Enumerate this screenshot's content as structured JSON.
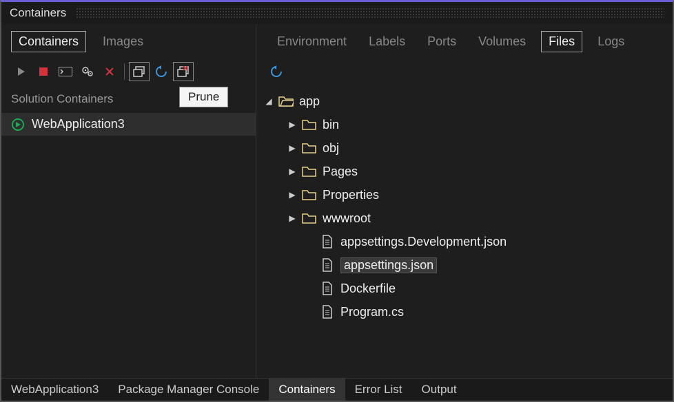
{
  "window": {
    "title": "Containers"
  },
  "leftTabs": {
    "containers": "Containers",
    "images": "Images"
  },
  "tooltip": "Prune",
  "sectionHeader": "Solution Containers",
  "solutionItems": [
    {
      "label": "WebApplication3"
    }
  ],
  "rightTabs": {
    "env": "Environment",
    "labels": "Labels",
    "ports": "Ports",
    "volumes": "Volumes",
    "files": "Files",
    "logs": "Logs"
  },
  "tree": {
    "root": "app",
    "folders": [
      "bin",
      "obj",
      "Pages",
      "Properties",
      "wwwroot"
    ],
    "files": [
      "appsettings.Development.json",
      "appsettings.json",
      "Dockerfile",
      "Program.cs"
    ],
    "selected": "appsettings.json"
  },
  "bottomTabs": {
    "t1": "WebApplication3",
    "t2": "Package Manager Console",
    "t3": "Containers",
    "t4": "Error List",
    "t5": "Output"
  },
  "colors": {
    "accent": "#6b5fd3",
    "stop": "#d13438",
    "folder": "#e8d18b",
    "refresh": "#3a96dd",
    "run": "#1aaa55"
  }
}
